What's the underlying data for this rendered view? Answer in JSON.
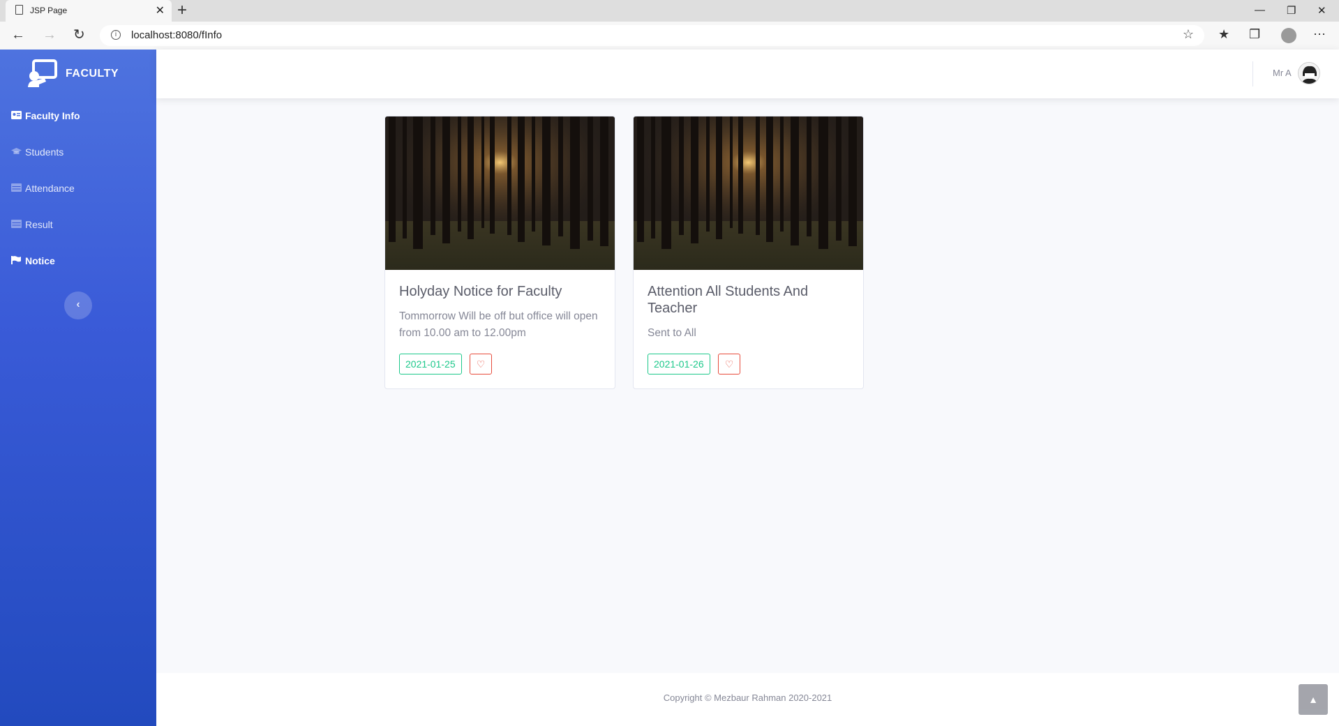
{
  "browser": {
    "tab_title": "JSP Page",
    "tab_close": "✕",
    "new_tab": "+",
    "url": "localhost:8080/fInfo"
  },
  "sidebar": {
    "brand": "FACULTY",
    "items": [
      {
        "label": "Faculty Info",
        "icon": "id-card-icon",
        "active": true
      },
      {
        "label": "Students",
        "icon": "graduation-cap-icon",
        "active": false
      },
      {
        "label": "Attendance",
        "icon": "table-icon",
        "active": false
      },
      {
        "label": "Result",
        "icon": "table-icon",
        "active": false
      },
      {
        "label": "Notice",
        "icon": "flag-icon",
        "active": true
      }
    ],
    "toggle_icon": "‹"
  },
  "topbar": {
    "user_name": "Mr A"
  },
  "notices": [
    {
      "title": "Holyday Notice for Faculty",
      "text": "Tommorrow Will be off but office will open from 10.00 am to 12.00pm",
      "date": "2021-01-25"
    },
    {
      "title": "Attention All Students And Teacher",
      "text": "Sent to All",
      "date": "2021-01-26"
    }
  ],
  "footer": {
    "copyright": "Copyright © Mezbaur Rahman 2020-2021"
  },
  "colors": {
    "primary": "#4e73df",
    "success": "#1cc88a",
    "danger": "#e74a3b"
  }
}
